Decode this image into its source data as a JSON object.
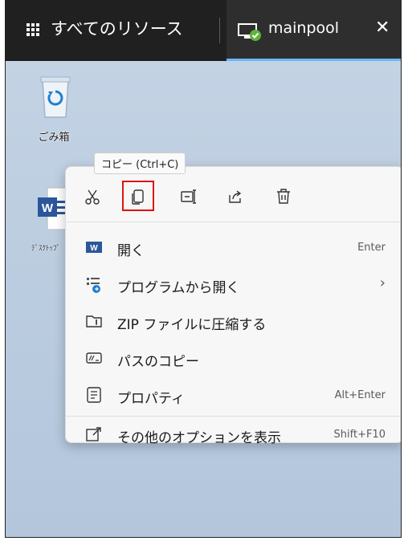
{
  "topbar": {
    "all_resources": "すべてのリソース",
    "tab_label": "mainpool",
    "close_glyph": "✕"
  },
  "desktop": {
    "recycle_bin_label": "ごみ箱",
    "word_file_label": "ﾃﾞｽｸﾄｯﾌﾟ"
  },
  "tooltip": "コピー (Ctrl+C)",
  "toolbar": [
    "cut",
    "copy",
    "rename",
    "share",
    "delete"
  ],
  "menu": {
    "items": [
      {
        "label": "開く",
        "shortcut": "Enter"
      },
      {
        "label": "プログラムから開く",
        "shortcut": "›"
      },
      {
        "label": "ZIP ファイルに圧縮する",
        "shortcut": ""
      },
      {
        "label": "パスのコピー",
        "shortcut": ""
      },
      {
        "label": "プロパティ",
        "shortcut": "Alt+Enter"
      },
      {
        "label": "その他のオプションを表示",
        "shortcut": "Shift+F10"
      }
    ]
  },
  "colors": {
    "highlight": "#e01010",
    "accent": "#6cb6ff",
    "word_blue": "#2b579a"
  }
}
